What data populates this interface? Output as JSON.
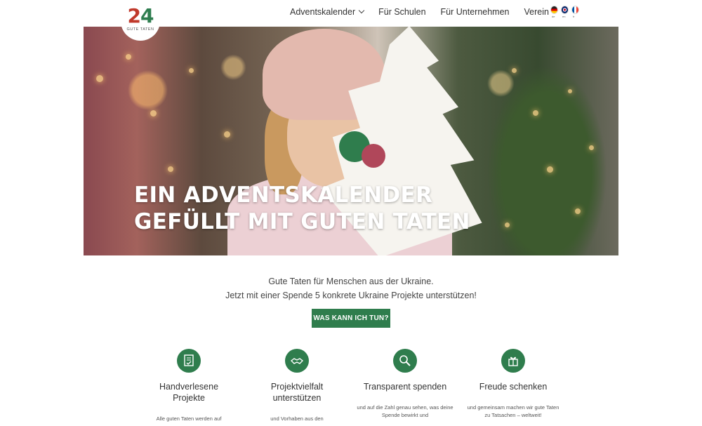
{
  "logo": {
    "number": "24",
    "first_digit": "2",
    "second_digit": "4",
    "subtitle": "GUTE TATEN"
  },
  "nav": {
    "items": [
      {
        "label": "Adventskalender",
        "has_dropdown": true
      },
      {
        "label": "Für Schulen",
        "has_dropdown": false
      },
      {
        "label": "Für Unternehmen",
        "has_dropdown": false
      },
      {
        "label": "Verein",
        "has_dropdown": true
      }
    ],
    "languages": [
      {
        "code": "de",
        "label": "de"
      },
      {
        "code": "en",
        "label": "en"
      },
      {
        "code": "fr",
        "label": "fr"
      }
    ]
  },
  "hero": {
    "title_line1": "EIN ADVENTSKALENDER",
    "title_line2": "GEFÜLLT MIT GUTEN TATEN"
  },
  "intro": {
    "line1": "Gute Taten für Menschen aus der Ukraine.",
    "line2": "Jetzt mit einer Spende 5 konkrete Ukraine Projekte unterstützen!"
  },
  "cta": {
    "label": "WAS KANN ICH TUN?"
  },
  "features": [
    {
      "icon": "certificate-icon",
      "title_line1": "Handverlesene",
      "title_line2": "Projekte",
      "text": "Alle guten Taten werden auf"
    },
    {
      "icon": "handshake-icon",
      "title_line1": "Projektvielfalt",
      "title_line2": "unterstützen",
      "text": "und Vorhaben aus den"
    },
    {
      "icon": "magnifier-icon",
      "title_line1": "Transparent spenden",
      "title_line2": "",
      "text": "und auf die Zahl genau sehen, was deine Spende bewirkt und"
    },
    {
      "icon": "gift-icon",
      "title_line1": "Freude schenken",
      "title_line2": "",
      "text": "und gemeinsam machen wir gute Taten zu Tatsachen – weltweit!"
    }
  ],
  "colors": {
    "brand_green": "#2f7d4d",
    "brand_red": "#c0392b"
  }
}
